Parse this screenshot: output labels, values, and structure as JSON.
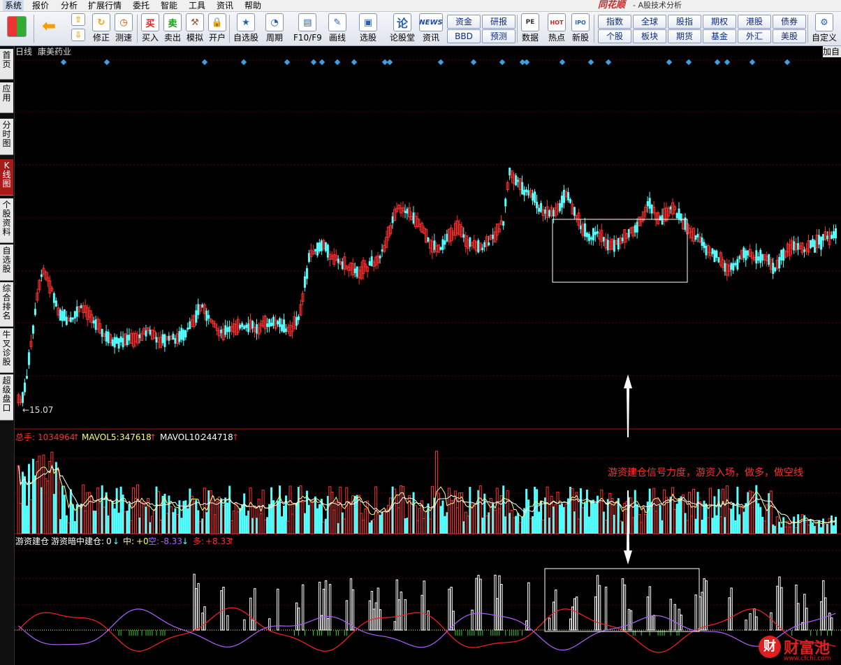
{
  "menu": [
    "系统",
    "报价",
    "分析",
    "扩展行情",
    "委托",
    "智能",
    "工具",
    "资讯",
    "帮助"
  ],
  "brand": "同花顺",
  "app_title": "- A股技术分析",
  "toolbar": {
    "buttons": [
      {
        "label": "修正",
        "icon": "refresh-icon"
      },
      {
        "label": "测速",
        "icon": "clock-icon"
      },
      {
        "label": "买入",
        "glyph": "买",
        "icon": "buy-icon"
      },
      {
        "label": "卖出",
        "glyph": "卖",
        "icon": "sell-icon"
      },
      {
        "label": "模拟",
        "icon": "gavel-icon"
      },
      {
        "label": "开户",
        "icon": "lock-icon"
      },
      {
        "label": "自选股",
        "icon": "star-folder-icon"
      },
      {
        "label": "周期",
        "icon": "clock-icon"
      },
      {
        "label": "F10/F9",
        "icon": "document-icon"
      },
      {
        "label": "画线",
        "icon": "pencil-icon"
      },
      {
        "label": "选股",
        "icon": "monitor-icon"
      },
      {
        "label": "论股堂",
        "glyph": "论",
        "icon": "forum-icon"
      },
      {
        "label": "资讯",
        "glyph": "NEWS",
        "icon": "news-icon"
      },
      {
        "label": "数据",
        "glyph": "PE",
        "icon": "data-icon"
      },
      {
        "label": "热点",
        "glyph": "HOT",
        "icon": "hot-icon"
      },
      {
        "label": "新股",
        "glyph": "IPO",
        "icon": "ipo-icon"
      },
      {
        "label": "自定义",
        "icon": "customize-icon"
      }
    ],
    "small_buttons": [
      "资金",
      "BBD",
      "研报",
      "预测",
      "指数",
      "个股",
      "全球",
      "板块",
      "股指",
      "期货",
      "期权",
      "基金",
      "港股",
      "外汇",
      "债券",
      "美股"
    ]
  },
  "sidebar": [
    "首页",
    "应用",
    "分时图",
    "K线图",
    "个股资料",
    "自选股",
    "综合排名",
    "牛叉诊股",
    "超级盘口"
  ],
  "chart": {
    "period": "日线",
    "stock_name": "康美药业",
    "add_button": "加自",
    "low_marker": "15.07",
    "volume_header": {
      "total_label": "总手:",
      "total_value": "1034964",
      "mavol5_label": "MAVOL5:",
      "mavol5_value": "347618",
      "mavol10_label": "MAVOL10:",
      "mavol10_value": "244718"
    },
    "indicator_header": {
      "name": "游资建仓",
      "hidden_label": "游资暗中建仓:",
      "hidden_value": "0",
      "mid_label": "中:",
      "mid_value": "+0",
      "empty_label": "空:",
      "empty_value": "-8.33",
      "long_label": "多:",
      "long_value": "+8.33"
    },
    "annotation": "游资建仓信号力度，游资入场，做多，做空线",
    "colors": {
      "up": "#ff3030",
      "down": "#54ffff",
      "ma5": "#ffff80",
      "ma10": "#ffffff",
      "short_line": "#b060ff",
      "long_line": "#ff2020",
      "box": "#ffffff"
    }
  },
  "watermark": {
    "text": "财富池",
    "logo_glyph": "财",
    "url": "www.cfchi.com"
  }
}
